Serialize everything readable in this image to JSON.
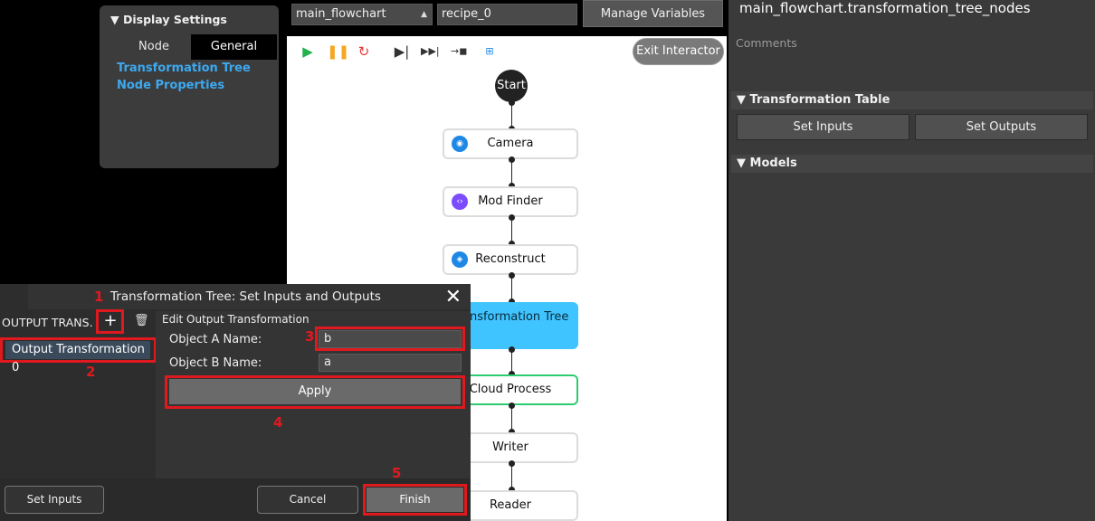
{
  "display_settings": {
    "header": "Display Settings",
    "tabs": [
      "Node",
      "General"
    ],
    "links": [
      "Transformation Tree",
      "Node Properties"
    ]
  },
  "toolbar": {
    "flowchart_select": "main_flowchart",
    "recipe_select": "recipe_0",
    "manage_variables": "Manage Variables"
  },
  "canvas": {
    "exit_button": "Exit Interactor",
    "start_label": "Start",
    "nodes": [
      {
        "label": "Camera",
        "icon": "camera-icon",
        "color": "#1e88e5"
      },
      {
        "label": "Mod Finder",
        "icon": "code-icon",
        "color": "#7c4dff"
      },
      {
        "label": "Reconstruct",
        "icon": "cube-icon",
        "color": "#1e88e5"
      },
      {
        "label": "Transformation Tree",
        "icon": "",
        "color": "#40c4ff"
      },
      {
        "label": "Cloud Process",
        "icon": "",
        "color": "#2ecc71"
      },
      {
        "label": "Writer",
        "icon": "",
        "color": ""
      },
      {
        "label": "Reader",
        "icon": "",
        "color": ""
      }
    ]
  },
  "right_panel": {
    "title": "main_flowchart.transformation_tree_nodes",
    "comments_label": "Comments",
    "transformation_table_header": "Transformation Table",
    "set_inputs": "Set Inputs",
    "set_outputs": "Set Outputs",
    "models_header": "Models"
  },
  "dialog": {
    "title": "Transformation Tree: Set Inputs and Outputs",
    "output_trans_label": "OUTPUT TRANS.",
    "output_item": "Output Transformation 0",
    "edit_header": "Edit Output Transformation",
    "object_a_label": "Object A Name:",
    "object_a_value": "b",
    "object_b_label": "Object B Name:",
    "object_b_value": "a",
    "apply": "Apply",
    "set_inputs": "Set Inputs",
    "cancel": "Cancel",
    "finish": "Finish",
    "steps": [
      "1",
      "2",
      "3",
      "4",
      "5"
    ]
  },
  "colors": {
    "highlight_red": "#e0191f",
    "link_blue": "#3da9f0",
    "selected_node": "#40c4ff"
  }
}
